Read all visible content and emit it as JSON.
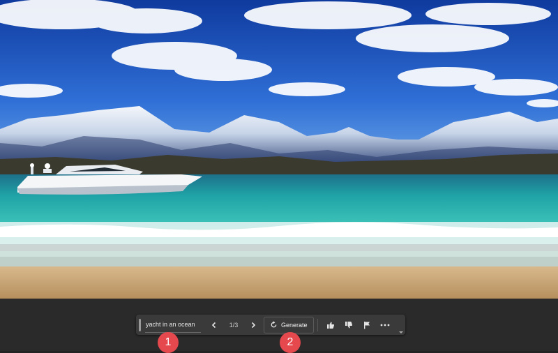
{
  "toolbar": {
    "prompt_text": "yacht in an ocean",
    "variation_counter": "1/3",
    "generate_label": "Generate",
    "icons": [
      "previous-chevron-icon",
      "next-chevron-icon",
      "regenerate-icon",
      "thumbs-up-icon",
      "thumbs-down-icon",
      "flag-icon",
      "more-icon"
    ]
  },
  "callouts": [
    "1",
    "2"
  ],
  "colors": {
    "callout": "#e5484d",
    "toolbar_bg": "#3a3a3a",
    "background": "#2a2a2a"
  }
}
